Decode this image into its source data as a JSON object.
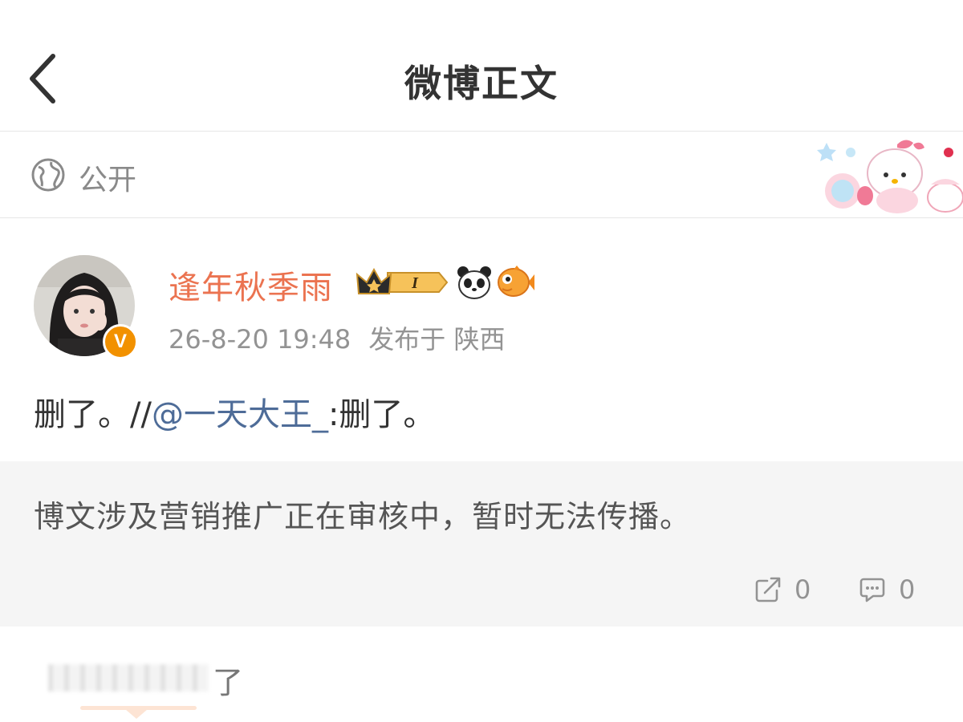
{
  "nav": {
    "title": "微博正文"
  },
  "visibility": {
    "label": "公开"
  },
  "post": {
    "author": "逢年秋季雨",
    "crown_badge_text": "I",
    "timestamp": "26-8-20 19:48",
    "location": "发布于 陕西",
    "text_before": "删了。//",
    "mention": "@一天大王_",
    "text_after": ":删了。",
    "icons": [
      "back-icon",
      "globe-icon",
      "verified-v-icon",
      "crown-level-icon",
      "panda-icon",
      "fish-icon",
      "repost-icon",
      "comment-icon"
    ],
    "verified_mark": "V"
  },
  "notice": {
    "text": "博文涉及营销推广正在审核中，暂时无法传播。"
  },
  "actions": {
    "repost_count": "0",
    "comment_count": "0"
  },
  "comment_preview": {
    "visible_tail": "了"
  },
  "colors": {
    "username": "#eb7350",
    "mention": "#4e6c98",
    "notice_bg": "#f5f5f5",
    "badge": "#f29100"
  }
}
